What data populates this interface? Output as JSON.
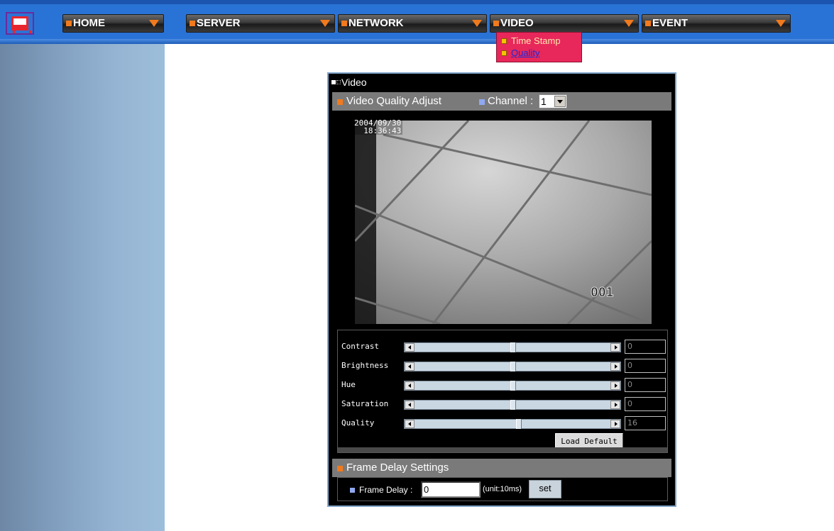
{
  "nav": {
    "home": "HOME",
    "server": "SERVER",
    "network": "NETWORK",
    "video": "VIDEO",
    "event": "EVENT"
  },
  "dropdown": {
    "time_stamp": "Time Stamp",
    "quality": "Quality"
  },
  "panel": {
    "title": "Video",
    "section_title": "Video Quality Adjust",
    "channel_label": "Channel :",
    "channel_value": "1",
    "video_date": "2004/09/30",
    "video_time": "18:36:43",
    "video_channel": "001"
  },
  "adjust": {
    "rows": [
      {
        "label": "Contrast",
        "value": "0",
        "level": 0.5
      },
      {
        "label": "Brightness",
        "value": "0",
        "level": 0.5
      },
      {
        "label": "Hue",
        "value": "0",
        "level": 0.5
      },
      {
        "label": "Saturation",
        "value": "0",
        "level": 0.5
      },
      {
        "label": "Quality",
        "value": "16",
        "level": 0.53
      }
    ],
    "load_default": "Load Default"
  },
  "frame": {
    "section_title": "Frame Delay Settings",
    "label": "Frame Delay :",
    "value": "0",
    "unit": "(unit:10ms)",
    "set": "set"
  },
  "colors": {
    "nav_bg": "#2a73d6",
    "accent_orange": "#f07a1d",
    "dropdown_bg": "#e8275a",
    "panel_border": "#7ea3c8"
  }
}
